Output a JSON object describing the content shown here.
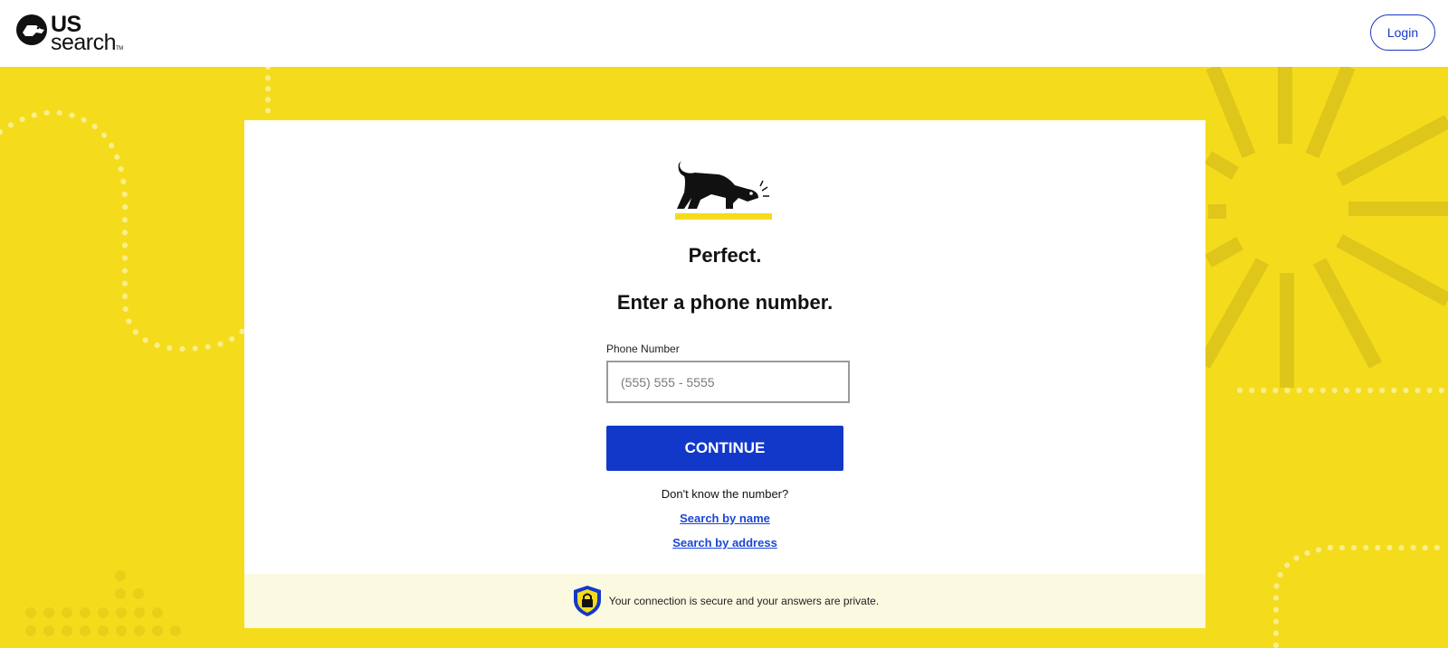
{
  "header": {
    "logo_us": "US",
    "logo_search": "search",
    "logo_tm": "TM",
    "login_label": "Login"
  },
  "main": {
    "heading_perfect": "Perfect.",
    "heading_enter": "Enter a phone number.",
    "phone_label": "Phone Number",
    "phone_placeholder": "(555) 555 - 5555",
    "phone_value": "",
    "continue_label": "CONTINUE",
    "dont_know": "Don't know the number?",
    "search_by_name": "Search by name",
    "search_by_address": "Search by address"
  },
  "footer": {
    "secure_note": "Your connection is secure and your answers are private."
  },
  "colors": {
    "brand_yellow": "#f4dc1d",
    "accent_blue": "#1238c9",
    "link_blue": "#1a46d8",
    "footer_bg": "#fcf9e1"
  },
  "icons": [
    "logo-dog-icon",
    "dog-illustration-icon",
    "shield-lock-icon"
  ]
}
